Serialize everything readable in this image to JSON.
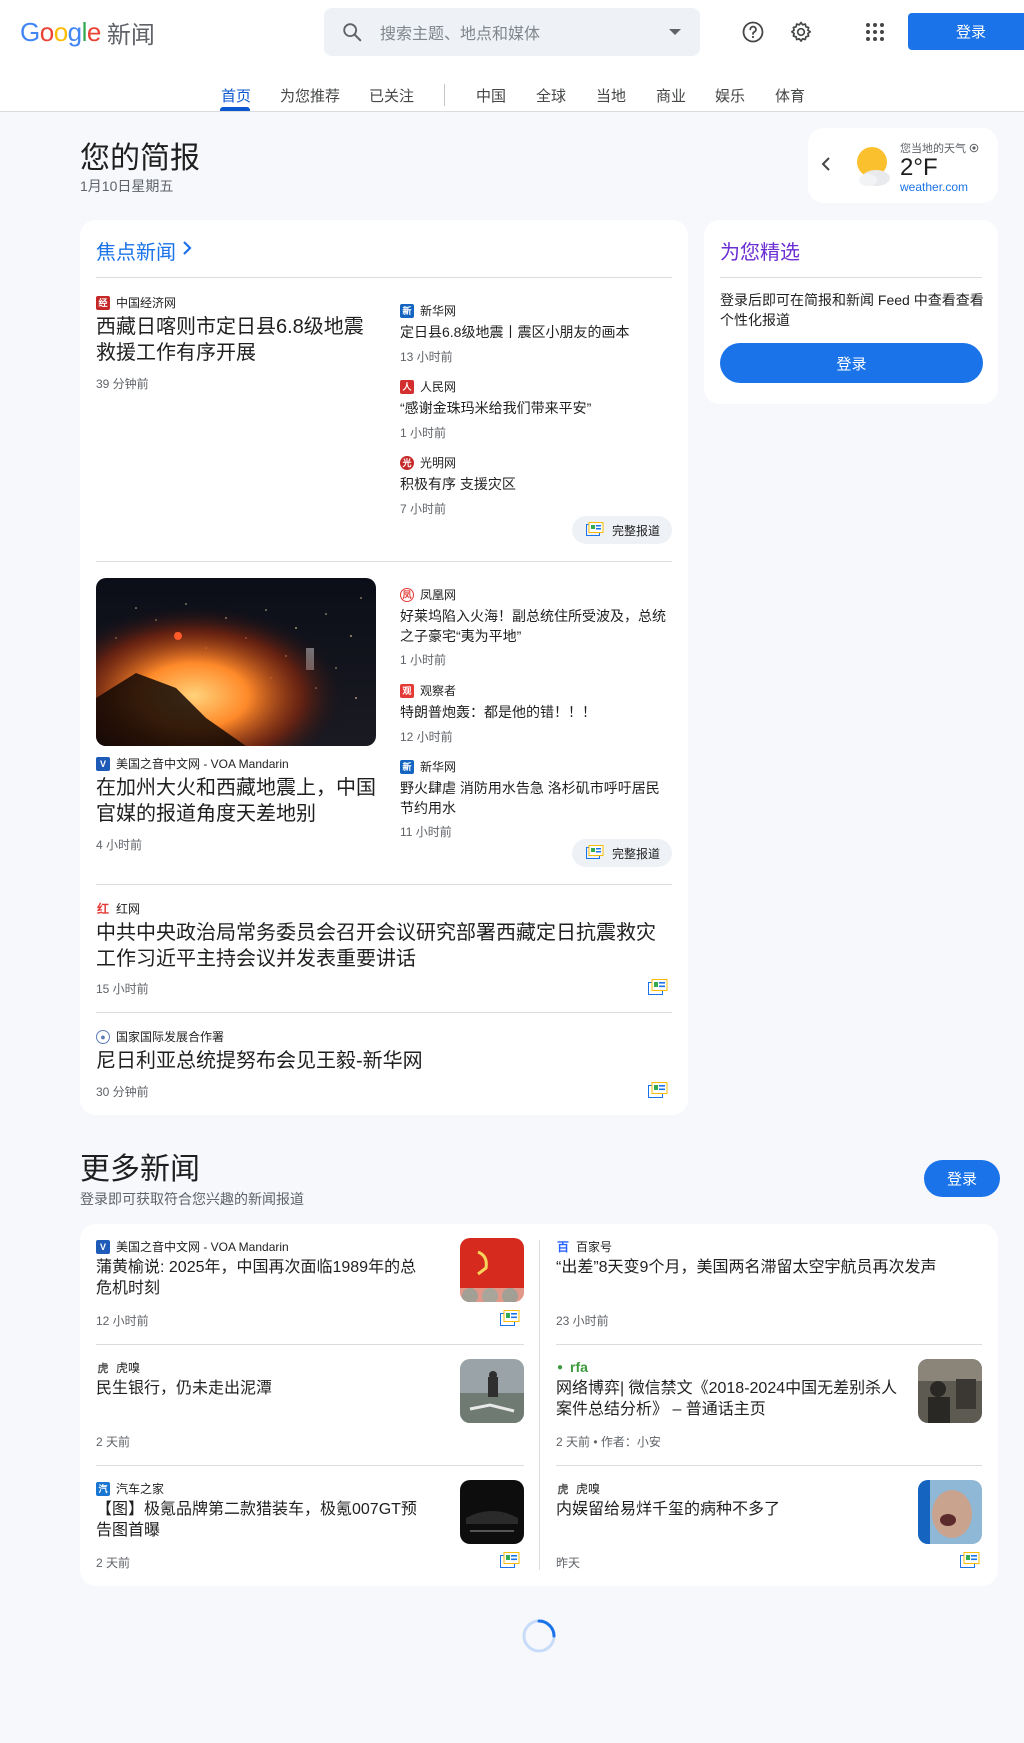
{
  "header": {
    "logo_letters": [
      "G",
      "o",
      "o",
      "g",
      "l",
      "e"
    ],
    "product": "新闻",
    "search_placeholder": "搜索主题、地点和媒体",
    "signin_label": "登录"
  },
  "nav": {
    "tabs": [
      "首页",
      "为您推荐",
      "已关注",
      "中国",
      "全球",
      "当地",
      "商业",
      "娱乐",
      "体育"
    ],
    "active": "首页"
  },
  "briefing": {
    "title": "您的简报",
    "date": "1月10日星期五"
  },
  "weather": {
    "label": "您当地的天气",
    "temp": "2°F",
    "source": "weather.com"
  },
  "top_stories": {
    "heading": "焦点新闻",
    "cluster1": {
      "main": {
        "source": "中国经济网",
        "title": "西藏日喀则市定日县6.8级地震救援工作有序开展",
        "time": "39 分钟前"
      },
      "side": [
        {
          "source": "新华网",
          "title": "定日县6.8级地震丨震区小朋友的画本",
          "time": "13 小时前"
        },
        {
          "source": "人民网",
          "title": "“感谢金珠玛米给我们带来平安”",
          "time": "1 小时前"
        },
        {
          "source": "光明网",
          "title": "积极有序 支援灾区",
          "time": "7 小时前"
        }
      ],
      "full_coverage": "完整报道"
    },
    "cluster2": {
      "main": {
        "source": "美国之音中文网 - VOA Mandarin",
        "title": "在加州大火和西藏地震上，中国官媒的报道角度天差地别",
        "time": "4 小时前"
      },
      "side": [
        {
          "source": "凤凰网",
          "title": "好莱坞陷入火海！副总统住所受波及，总统之子豪宅“夷为平地”",
          "time": "1 小时前"
        },
        {
          "source": "观察者",
          "title": "特朗普炮轰：都是他的错！！！",
          "time": "12 小时前"
        },
        {
          "source": "新华网",
          "title": "野火肆虐 消防用水告急 洛杉矶市呼吁居民节约用水",
          "time": "11 小时前"
        }
      ],
      "full_coverage": "完整报道"
    },
    "single1": {
      "source": "红网",
      "title": "中共中央政治局常务委员会召开会议研究部署西藏定日抗震救灾工作习近平主持会议并发表重要讲话",
      "time": "15 小时前"
    },
    "single2": {
      "source": "国家国际发展合作署",
      "title": "尼日利亚总统提努布会见王毅-新华网",
      "time": "30 分钟前"
    }
  },
  "picks": {
    "heading": "为您精选",
    "text": "登录后即可在简报和新闻 Feed 中查看查看个性化报道",
    "button": "登录"
  },
  "more_news": {
    "title": "更多新闻",
    "subtitle": "登录即可获取符合您兴趣的新闻报道",
    "button": "登录",
    "items": [
      {
        "source": "美国之音中文网 - VOA Mandarin",
        "title": "蒲黄榆说: 2025年，中国再次面临1989年的总危机时刻",
        "time": "12 小时前"
      },
      {
        "source": "百家号",
        "title": "“出差”8天变9个月，美国两名滞留太空宇航员再次发声",
        "time": "23 小时前"
      },
      {
        "source": "虎嗅",
        "title": "民生银行，仍未走出泥潭",
        "time": "2 天前"
      },
      {
        "source": "rfa",
        "title": "网络博弈| 微信禁文《2018-2024中国无差别杀人案件总结分析》 – 普通话主页",
        "time": "2 天前 • 作者：小安"
      },
      {
        "source": "汽车之家",
        "title": "【图】极氪品牌第二款猎装车，极氪007GT预告图首曝",
        "time": "2 天前"
      },
      {
        "source": "虎嗅",
        "title": "内娱留给易烊千玺的病种不多了",
        "time": "昨天"
      }
    ]
  },
  "colors": {
    "accent": "#1a73e8",
    "active_tab": "#0b57d0",
    "page_bg": "#f6f8fc"
  }
}
